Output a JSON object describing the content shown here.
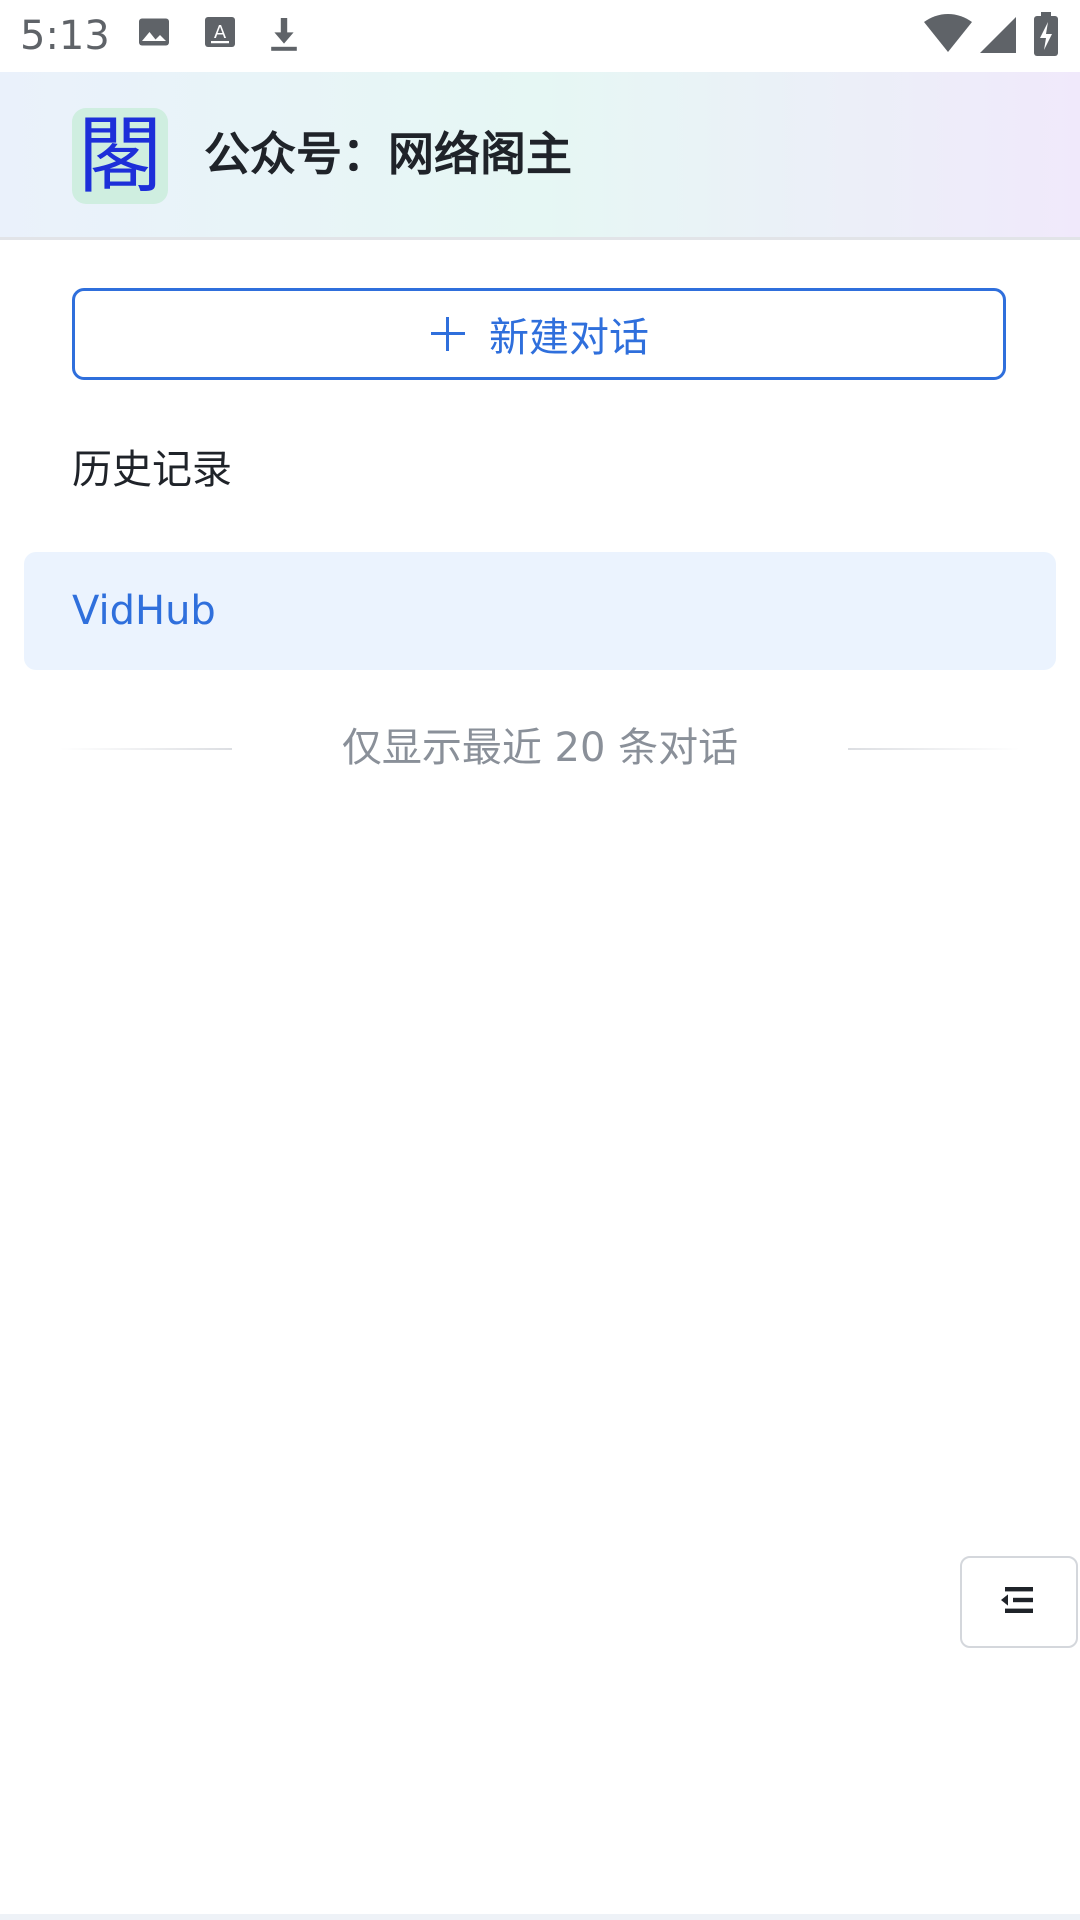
{
  "status_bar": {
    "time": "5:13",
    "left_icons": [
      "image-icon",
      "text-recognition-icon",
      "download-icon"
    ],
    "right_icons": [
      "wifi-icon",
      "cell-signal-icon",
      "battery-charging-icon"
    ]
  },
  "header": {
    "logo_char": "閣",
    "title": "公众号：网络阁主"
  },
  "drawer": {
    "new_chat_label": "新建对话",
    "history_title": "历史记录",
    "history_items": [
      {
        "label": "VidHub"
      }
    ],
    "footer_note": "仅显示最近 20 条对话"
  },
  "colors": {
    "accent": "#2f6fdc",
    "selected_bg": "#ebf3fe",
    "muted_text": "#8a9099"
  }
}
